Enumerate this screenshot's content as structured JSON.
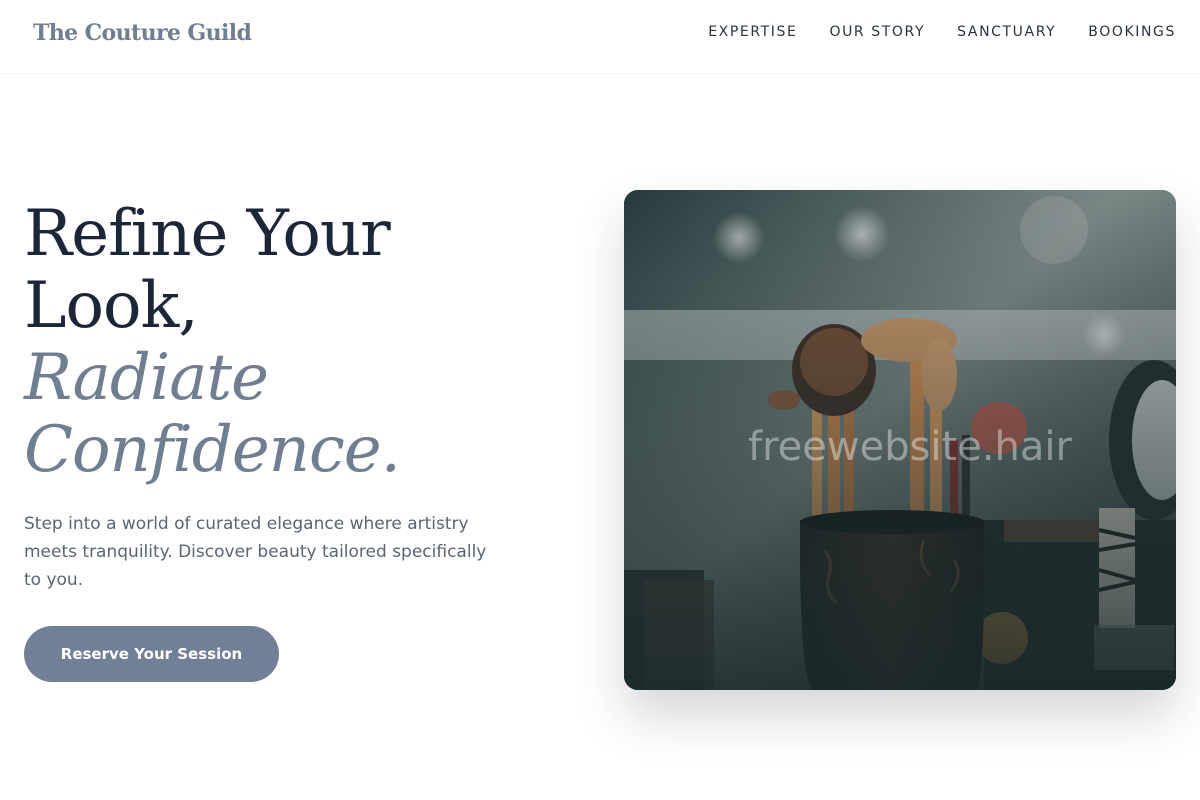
{
  "brand": "The Couture Guild",
  "nav": [
    "EXPERTISE",
    "OUR STORY",
    "SANCTUARY",
    "BOOKINGS"
  ],
  "hero": {
    "title_line1": "Refine Your",
    "title_line2": "Look,",
    "accent_line1": "Radiate",
    "accent_line2": "Confidence.",
    "description": "Step into a world of curated elegance where artistry meets tranquility. Discover beauty tailored specifically to you.",
    "cta_label": "Reserve Your Session"
  },
  "photo": {
    "watermark": "freewebsite.hair"
  },
  "colors": {
    "accent": "#718096",
    "heading": "#1c2639",
    "body": "#5a6472"
  }
}
